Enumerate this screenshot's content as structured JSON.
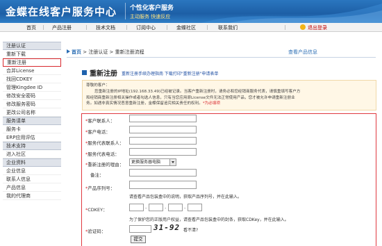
{
  "header": {
    "logo": "金蝶在线客户服务中心",
    "slogan_title": "个性化客户服务",
    "slogan_sub": "主动服务  快速反应"
  },
  "nav": {
    "items": [
      "首页",
      "产品注册",
      "技术文档",
      "订阅中心",
      "金蝶社区",
      "联系我们"
    ],
    "logout": "退出登录"
  },
  "sidebar": {
    "sections": [
      {
        "title": "注册认证",
        "items": [
          "重新下载",
          "重新注册",
          "合并License",
          "找回CDKEY",
          "管理Kingdee ID",
          "修改安全密码",
          "修改服务密码",
          "更改公司名称"
        ]
      },
      {
        "title": "服务请单",
        "items": [
          "服务卡",
          "ERP应用评估"
        ]
      },
      {
        "title": "技术支持",
        "items": [
          "进入社区"
        ]
      },
      {
        "title": "企业资料",
        "items": [
          "企业信息",
          "联系人信息",
          "产品信息",
          "我的代理商"
        ]
      }
    ],
    "active": "重新注册"
  },
  "breadcrumb": {
    "home": "首页",
    "path": " > 注册认证 > 重新注册流程",
    "view_product": "查看产品信息"
  },
  "page": {
    "title": "重新注册",
    "title_links": "重新注册手续办理指南   下载打印\"重新注册\"申请表单"
  },
  "notice": {
    "line1": "尊敬的客户：",
    "line2": "您重新注册的IP地址(192.168.33.49)已经被记录。当客户重新注册时，请务必和您经销商服务代表，请慎重填写客户方",
    "line3": "和经销商重新注册相关操作或者勾选人信息，只有当您应用原License文件无法正常使用产品，您才被允许申请重新注册业",
    "line4": "务。如遇非真实情况恶意重新注册，金蝶保留追究相关责任的权利。",
    "required": "*为必填项"
  },
  "form": {
    "contact": "客户联系人：",
    "phone": "客户电话：",
    "rep_contact": "服务代表联系人：",
    "rep_phone": "服务代表电话：",
    "reason_label": "重新注册的理由：",
    "reason_value": "更换服务器电脑",
    "remark": "备注：",
    "serial": "产品序列号：",
    "serial_hint": "请查看产品包装盒中的说明，获取产品序列号，并在此输入。",
    "cdkey": "CDKEY：",
    "cdkey_hint": "为了保护您的正版用户权益，请查看产品包装盒中的封条，获取CDKey，并在此输入。",
    "captcha_label": "验证码：",
    "captcha_value": "31-92",
    "captcha_q": "看不清?",
    "submit": "提交",
    "star": "*"
  }
}
